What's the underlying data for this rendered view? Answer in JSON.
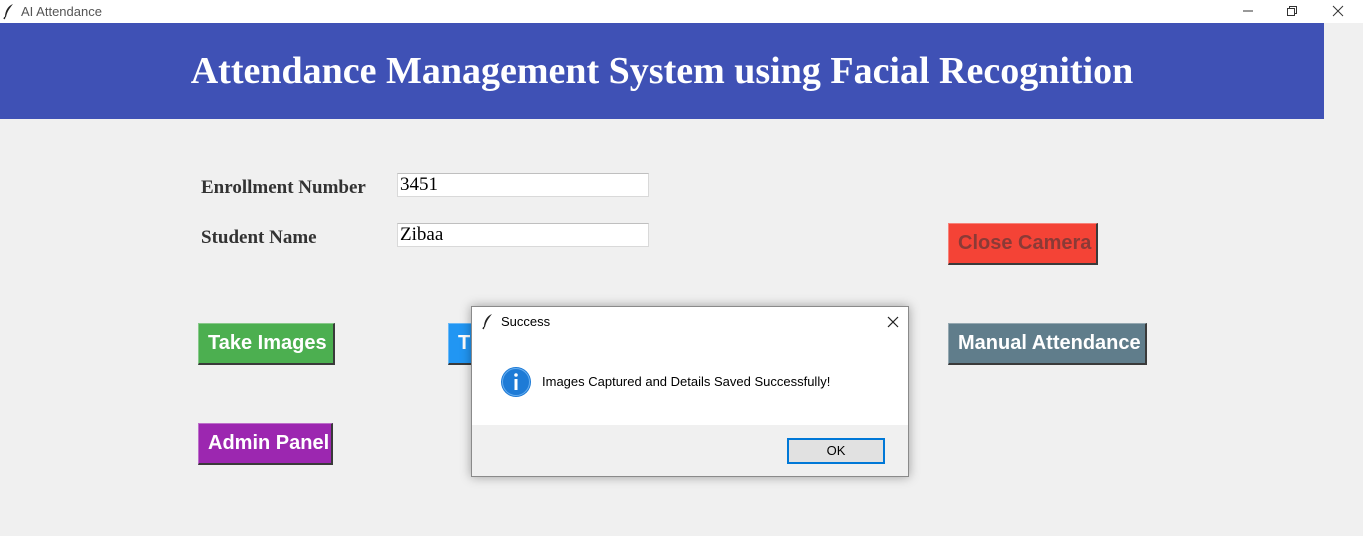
{
  "window": {
    "title": "AI Attendance",
    "icon": "feather-icon",
    "controls": [
      "minimize-icon",
      "restore-icon",
      "close-icon"
    ]
  },
  "header": {
    "title": "Attendance Management System using Facial Recognition",
    "background": "#3f51b5"
  },
  "form": {
    "enrollment_label": "Enrollment Number",
    "enrollment_value": "3451",
    "name_label": "Student Name",
    "name_value": "Zibaa"
  },
  "buttons": {
    "take_images": {
      "label": "Take Images",
      "color": "#4caf50",
      "text_color": "#ffffff"
    },
    "train": {
      "label": "T",
      "color": "#2196f3",
      "text_color": "#ffffff"
    },
    "close_camera": {
      "label": "Close Camera",
      "color": "#f44336",
      "text_color": "#8b3a36"
    },
    "manual_attendance": {
      "label": "Manual Attendance",
      "color": "#607d8b",
      "text_color": "#ffffff"
    },
    "admin_panel": {
      "label": "Admin Panel",
      "color": "#9c27b0",
      "text_color": "#ffffff"
    }
  },
  "dialog": {
    "title": "Success",
    "icon": "info-icon",
    "message": "Images Captured and Details Saved Successfully!",
    "ok_label": "OK",
    "accent": "#0078d7"
  }
}
